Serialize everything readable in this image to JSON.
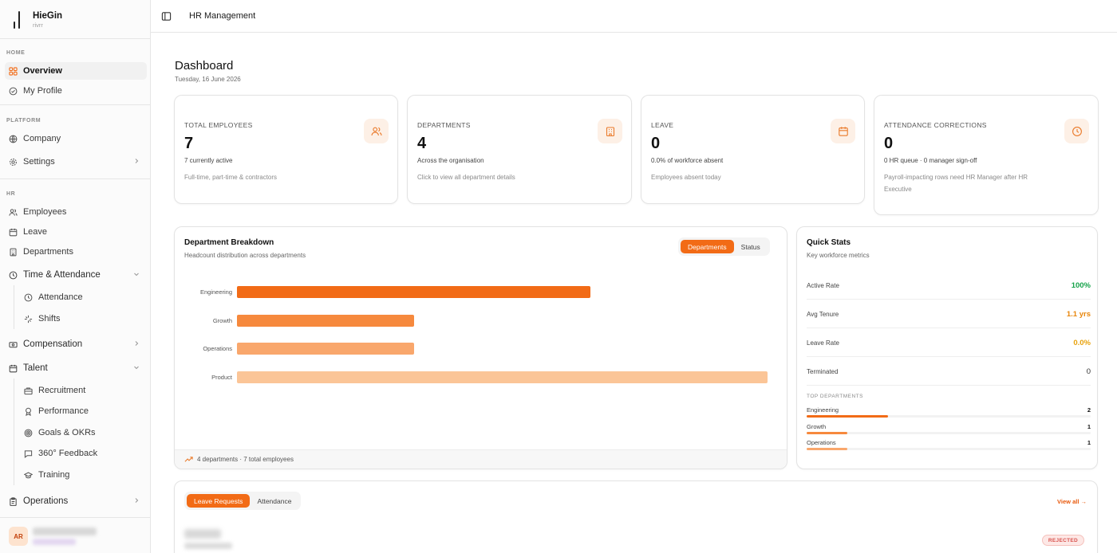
{
  "brand": {
    "name": "HieGin",
    "sub": "rivrr"
  },
  "sidebar": {
    "sections": {
      "home": "HOME",
      "platform": "PLATFORM",
      "hr": "HR"
    },
    "home": [
      {
        "label": "Overview",
        "icon": "grid-icon"
      },
      {
        "label": "My Profile",
        "icon": "check-circle-icon"
      }
    ],
    "platform": [
      {
        "label": "Company",
        "icon": "globe-icon"
      },
      {
        "label": "Settings",
        "icon": "gear-icon"
      }
    ],
    "hr": {
      "employees": "Employees",
      "leave": "Leave",
      "departments": "Departments",
      "time_attendance": "Time & Attendance",
      "attendance": "Attendance",
      "shifts": "Shifts",
      "compensation": "Compensation",
      "talent": "Talent",
      "recruitment": "Recruitment",
      "performance": "Performance",
      "goals": "Goals & OKRs",
      "feedback": "360° Feedback",
      "training": "Training",
      "operations": "Operations"
    },
    "user": {
      "initials": "AR"
    }
  },
  "header": {
    "title": "HR Management"
  },
  "dashboard": {
    "title": "Dashboard",
    "date": "Tuesday, 16 June 2026"
  },
  "stats": [
    {
      "label": "TOTAL EMPLOYEES",
      "value": "7",
      "line1": "7 currently active",
      "line2": "Full-time, part-time & contractors",
      "icon": "users-icon"
    },
    {
      "label": "DEPARTMENTS",
      "value": "4",
      "line1": "Across the organisation",
      "line2": "Click to view all department details",
      "icon": "building-icon"
    },
    {
      "label": "LEAVE",
      "value": "0",
      "line1": "0.0% of workforce absent",
      "line2": "Employees absent today",
      "icon": "calendar-icon"
    },
    {
      "label": "ATTENDANCE CORRECTIONS",
      "value": "0",
      "line1": "0 HR queue · 0 manager sign-off",
      "line2": "Payroll-impacting rows need HR Manager after HR Executive",
      "icon": "clock-icon"
    }
  ],
  "breakdown": {
    "title": "Department Breakdown",
    "subtitle": "Headcount distribution across departments",
    "tabs": [
      "Departments",
      "Status"
    ],
    "footer": "4 departments · 7 total employees"
  },
  "chart_data": {
    "type": "bar",
    "orientation": "horizontal",
    "categories": [
      "Engineering",
      "Growth",
      "Operations",
      "Product"
    ],
    "values": [
      2,
      1,
      1,
      3
    ],
    "colors": [
      "#f26b16",
      "#f6893d",
      "#f9a76c",
      "#fbc597"
    ],
    "xlim": [
      0,
      3
    ],
    "grid": false,
    "legend": "none"
  },
  "quick_stats": {
    "title": "Quick Stats",
    "subtitle": "Key workforce metrics",
    "rows": [
      {
        "label": "Active Rate",
        "value": "100%",
        "color": "#16a34a"
      },
      {
        "label": "Avg Tenure",
        "value": "1.1 yrs",
        "color": "#e8860c"
      },
      {
        "label": "Leave Rate",
        "value": "0.0%",
        "color": "#e8a20c"
      },
      {
        "label": "Terminated",
        "value": "0",
        "color": "#333333"
      }
    ],
    "top_departments_label": "TOP DEPARTMENTS",
    "top_departments": [
      {
        "name": "Engineering",
        "count": "2",
        "share": 0.286,
        "color": "#f26b16"
      },
      {
        "name": "Growth",
        "count": "1",
        "share": 0.143,
        "color": "#f6893d"
      },
      {
        "name": "Operations",
        "count": "1",
        "share": 0.143,
        "color": "#f9a76c"
      }
    ]
  },
  "requests": {
    "tabs": [
      "Leave Requests",
      "Attendance"
    ],
    "view_all": "View all →",
    "status": "REJECTED"
  }
}
